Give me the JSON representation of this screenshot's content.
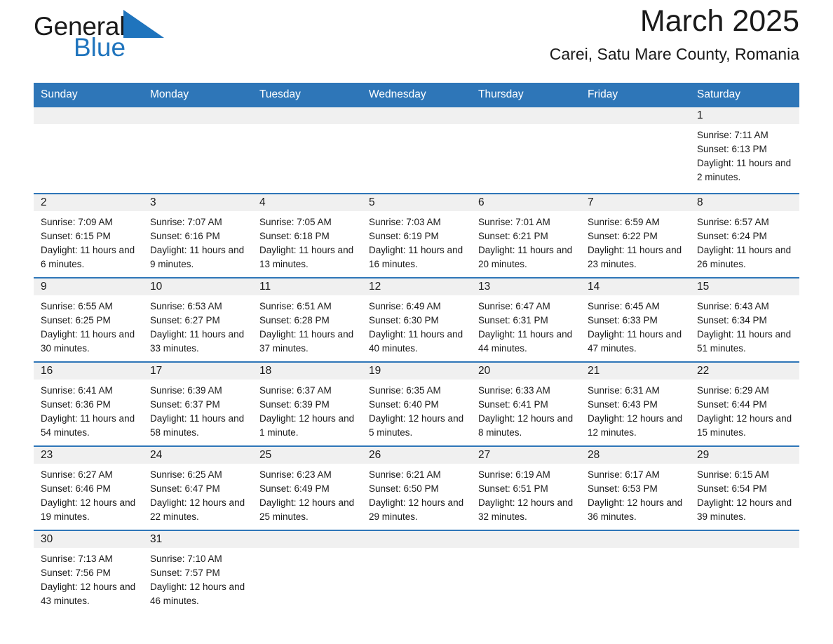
{
  "brand": {
    "name_part1": "General",
    "name_part2": "Blue",
    "triangle_color": "#1f74bd"
  },
  "header": {
    "title": "March 2025",
    "subtitle": "Carei, Satu Mare County, Romania"
  },
  "theme": {
    "header_blue": "#2e76b8",
    "daynum_band": "#f0f0f0",
    "text": "#1a1a1a"
  },
  "weekdays": [
    "Sunday",
    "Monday",
    "Tuesday",
    "Wednesday",
    "Thursday",
    "Friday",
    "Saturday"
  ],
  "weeks": [
    [
      {
        "day": "",
        "sunrise": "",
        "sunset": "",
        "daylight": ""
      },
      {
        "day": "",
        "sunrise": "",
        "sunset": "",
        "daylight": ""
      },
      {
        "day": "",
        "sunrise": "",
        "sunset": "",
        "daylight": ""
      },
      {
        "day": "",
        "sunrise": "",
        "sunset": "",
        "daylight": ""
      },
      {
        "day": "",
        "sunrise": "",
        "sunset": "",
        "daylight": ""
      },
      {
        "day": "",
        "sunrise": "",
        "sunset": "",
        "daylight": ""
      },
      {
        "day": "1",
        "sunrise": "Sunrise: 7:11 AM",
        "sunset": "Sunset: 6:13 PM",
        "daylight": "Daylight: 11 hours and 2 minutes."
      }
    ],
    [
      {
        "day": "2",
        "sunrise": "Sunrise: 7:09 AM",
        "sunset": "Sunset: 6:15 PM",
        "daylight": "Daylight: 11 hours and 6 minutes."
      },
      {
        "day": "3",
        "sunrise": "Sunrise: 7:07 AM",
        "sunset": "Sunset: 6:16 PM",
        "daylight": "Daylight: 11 hours and 9 minutes."
      },
      {
        "day": "4",
        "sunrise": "Sunrise: 7:05 AM",
        "sunset": "Sunset: 6:18 PM",
        "daylight": "Daylight: 11 hours and 13 minutes."
      },
      {
        "day": "5",
        "sunrise": "Sunrise: 7:03 AM",
        "sunset": "Sunset: 6:19 PM",
        "daylight": "Daylight: 11 hours and 16 minutes."
      },
      {
        "day": "6",
        "sunrise": "Sunrise: 7:01 AM",
        "sunset": "Sunset: 6:21 PM",
        "daylight": "Daylight: 11 hours and 20 minutes."
      },
      {
        "day": "7",
        "sunrise": "Sunrise: 6:59 AM",
        "sunset": "Sunset: 6:22 PM",
        "daylight": "Daylight: 11 hours and 23 minutes."
      },
      {
        "day": "8",
        "sunrise": "Sunrise: 6:57 AM",
        "sunset": "Sunset: 6:24 PM",
        "daylight": "Daylight: 11 hours and 26 minutes."
      }
    ],
    [
      {
        "day": "9",
        "sunrise": "Sunrise: 6:55 AM",
        "sunset": "Sunset: 6:25 PM",
        "daylight": "Daylight: 11 hours and 30 minutes."
      },
      {
        "day": "10",
        "sunrise": "Sunrise: 6:53 AM",
        "sunset": "Sunset: 6:27 PM",
        "daylight": "Daylight: 11 hours and 33 minutes."
      },
      {
        "day": "11",
        "sunrise": "Sunrise: 6:51 AM",
        "sunset": "Sunset: 6:28 PM",
        "daylight": "Daylight: 11 hours and 37 minutes."
      },
      {
        "day": "12",
        "sunrise": "Sunrise: 6:49 AM",
        "sunset": "Sunset: 6:30 PM",
        "daylight": "Daylight: 11 hours and 40 minutes."
      },
      {
        "day": "13",
        "sunrise": "Sunrise: 6:47 AM",
        "sunset": "Sunset: 6:31 PM",
        "daylight": "Daylight: 11 hours and 44 minutes."
      },
      {
        "day": "14",
        "sunrise": "Sunrise: 6:45 AM",
        "sunset": "Sunset: 6:33 PM",
        "daylight": "Daylight: 11 hours and 47 minutes."
      },
      {
        "day": "15",
        "sunrise": "Sunrise: 6:43 AM",
        "sunset": "Sunset: 6:34 PM",
        "daylight": "Daylight: 11 hours and 51 minutes."
      }
    ],
    [
      {
        "day": "16",
        "sunrise": "Sunrise: 6:41 AM",
        "sunset": "Sunset: 6:36 PM",
        "daylight": "Daylight: 11 hours and 54 minutes."
      },
      {
        "day": "17",
        "sunrise": "Sunrise: 6:39 AM",
        "sunset": "Sunset: 6:37 PM",
        "daylight": "Daylight: 11 hours and 58 minutes."
      },
      {
        "day": "18",
        "sunrise": "Sunrise: 6:37 AM",
        "sunset": "Sunset: 6:39 PM",
        "daylight": "Daylight: 12 hours and 1 minute."
      },
      {
        "day": "19",
        "sunrise": "Sunrise: 6:35 AM",
        "sunset": "Sunset: 6:40 PM",
        "daylight": "Daylight: 12 hours and 5 minutes."
      },
      {
        "day": "20",
        "sunrise": "Sunrise: 6:33 AM",
        "sunset": "Sunset: 6:41 PM",
        "daylight": "Daylight: 12 hours and 8 minutes."
      },
      {
        "day": "21",
        "sunrise": "Sunrise: 6:31 AM",
        "sunset": "Sunset: 6:43 PM",
        "daylight": "Daylight: 12 hours and 12 minutes."
      },
      {
        "day": "22",
        "sunrise": "Sunrise: 6:29 AM",
        "sunset": "Sunset: 6:44 PM",
        "daylight": "Daylight: 12 hours and 15 minutes."
      }
    ],
    [
      {
        "day": "23",
        "sunrise": "Sunrise: 6:27 AM",
        "sunset": "Sunset: 6:46 PM",
        "daylight": "Daylight: 12 hours and 19 minutes."
      },
      {
        "day": "24",
        "sunrise": "Sunrise: 6:25 AM",
        "sunset": "Sunset: 6:47 PM",
        "daylight": "Daylight: 12 hours and 22 minutes."
      },
      {
        "day": "25",
        "sunrise": "Sunrise: 6:23 AM",
        "sunset": "Sunset: 6:49 PM",
        "daylight": "Daylight: 12 hours and 25 minutes."
      },
      {
        "day": "26",
        "sunrise": "Sunrise: 6:21 AM",
        "sunset": "Sunset: 6:50 PM",
        "daylight": "Daylight: 12 hours and 29 minutes."
      },
      {
        "day": "27",
        "sunrise": "Sunrise: 6:19 AM",
        "sunset": "Sunset: 6:51 PM",
        "daylight": "Daylight: 12 hours and 32 minutes."
      },
      {
        "day": "28",
        "sunrise": "Sunrise: 6:17 AM",
        "sunset": "Sunset: 6:53 PM",
        "daylight": "Daylight: 12 hours and 36 minutes."
      },
      {
        "day": "29",
        "sunrise": "Sunrise: 6:15 AM",
        "sunset": "Sunset: 6:54 PM",
        "daylight": "Daylight: 12 hours and 39 minutes."
      }
    ],
    [
      {
        "day": "30",
        "sunrise": "Sunrise: 7:13 AM",
        "sunset": "Sunset: 7:56 PM",
        "daylight": "Daylight: 12 hours and 43 minutes."
      },
      {
        "day": "31",
        "sunrise": "Sunrise: 7:10 AM",
        "sunset": "Sunset: 7:57 PM",
        "daylight": "Daylight: 12 hours and 46 minutes."
      },
      {
        "day": "",
        "sunrise": "",
        "sunset": "",
        "daylight": ""
      },
      {
        "day": "",
        "sunrise": "",
        "sunset": "",
        "daylight": ""
      },
      {
        "day": "",
        "sunrise": "",
        "sunset": "",
        "daylight": ""
      },
      {
        "day": "",
        "sunrise": "",
        "sunset": "",
        "daylight": ""
      },
      {
        "day": "",
        "sunrise": "",
        "sunset": "",
        "daylight": ""
      }
    ]
  ]
}
